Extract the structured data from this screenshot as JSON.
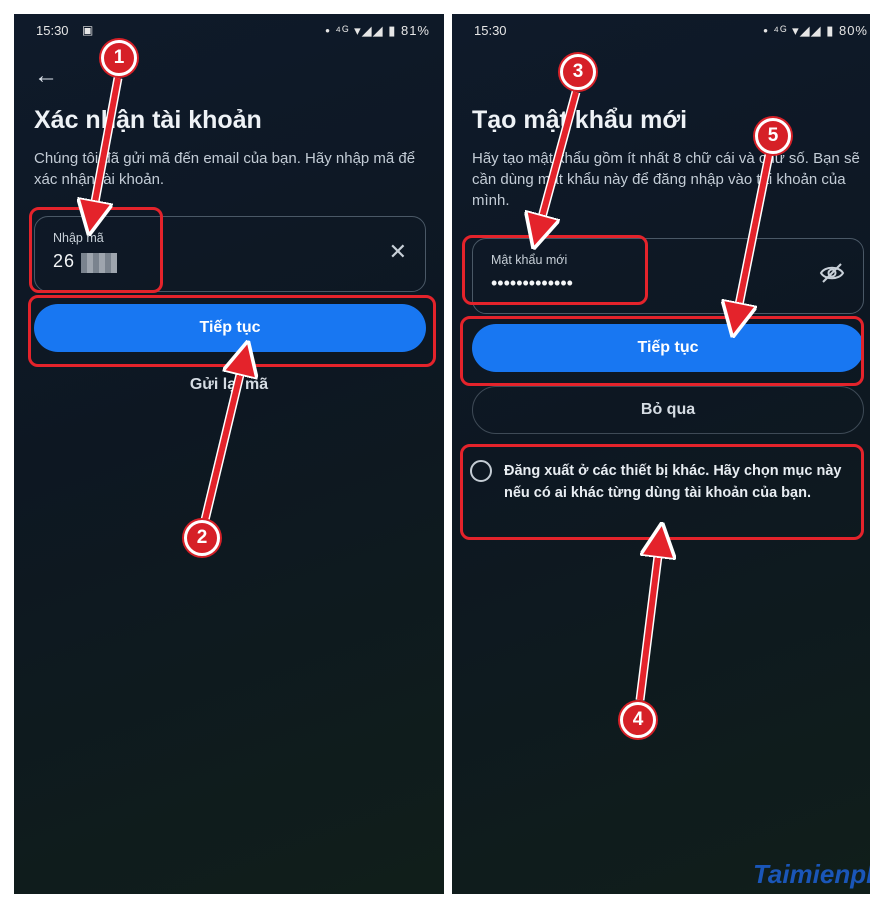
{
  "left": {
    "status": {
      "time": "15:30",
      "sim": "▣",
      "icons": "• ⁴ᴳ ▾◢◢ ▮ 81%"
    },
    "title": "Xác nhận tài khoản",
    "description": "Chúng tôi đã gửi mã đến email của bạn. Hãy nhập mã để xác nhận tài khoản.",
    "code_field": {
      "label": "Nhập mã",
      "value": "26",
      "clear": "✕"
    },
    "continue_label": "Tiếp tục",
    "resend_label": "Gửi lại mã"
  },
  "right": {
    "status": {
      "time": "15:30",
      "icons": "• ⁴ᴳ ▾◢◢ ▮ 80%"
    },
    "title": "Tạo mật khẩu mới",
    "description": "Hãy tạo mật khẩu gồm ít nhất 8 chữ cái và chữ số. Bạn sẽ cần dùng mật khẩu này để đăng nhập vào tài khoản của mình.",
    "password_field": {
      "label": "Mật khẩu mới",
      "value": "•••••••••••••"
    },
    "continue_label": "Tiếp tục",
    "skip_label": "Bỏ qua",
    "logout_text": "Đăng xuất ở các thiết bị khác. Hãy chọn mục này nếu có ai khác từng dùng tài khoản của bạn."
  },
  "markers": [
    "1",
    "2",
    "3",
    "4",
    "5"
  ],
  "watermark": "Taimienph",
  "colors": {
    "accent": "#1877f2",
    "highlight": "#e4232b",
    "background": "#0f1a2a"
  }
}
